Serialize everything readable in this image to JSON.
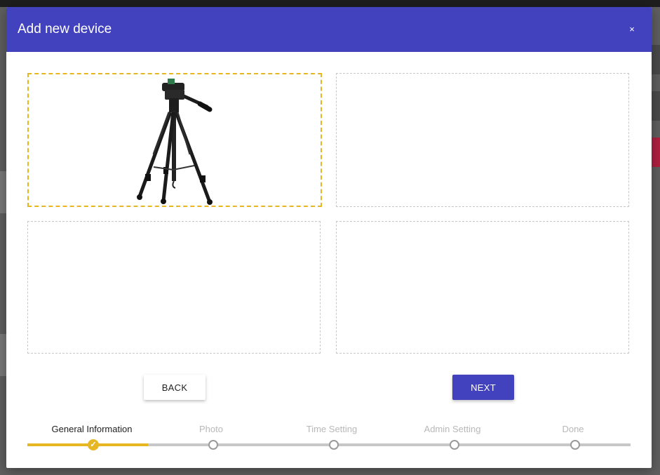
{
  "modal": {
    "title": "Add new device",
    "close_icon": "close-icon",
    "close_glyph": "×"
  },
  "photos": {
    "slots": [
      {
        "state": "filled",
        "image": "tripod"
      },
      {
        "state": "empty"
      },
      {
        "state": "empty"
      },
      {
        "state": "empty"
      }
    ]
  },
  "buttons": {
    "back_label": "BACK",
    "next_label": "NEXT"
  },
  "stepper": {
    "steps": [
      {
        "label": "General Information",
        "status": "done"
      },
      {
        "label": "Photo",
        "status": "pending"
      },
      {
        "label": "Time Setting",
        "status": "pending"
      },
      {
        "label": "Admin Setting",
        "status": "pending"
      },
      {
        "label": "Done",
        "status": "pending"
      }
    ],
    "check_glyph": "✓"
  },
  "colors": {
    "primary": "#4242bf",
    "accent": "#e7b623",
    "inactive": "#c8c8c8"
  }
}
